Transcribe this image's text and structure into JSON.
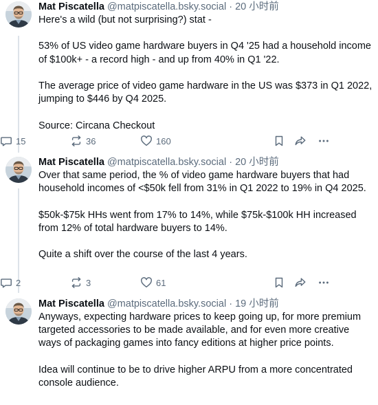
{
  "posts": [
    {
      "author": "Mat Piscatella",
      "handle": "@matpiscatella.bsky.social",
      "separator": "·",
      "time": "20 小时前",
      "paragraphs": [
        "Here's a wild (but not surprising?) stat -",
        "53% of US video game hardware buyers in Q4 '25 had a household income of $100k+ - a record high - and up from 40% in Q1 '22.",
        "The average price of video game hardware in the US was $373 in Q1 2022, jumping to $446 by Q4 2025.",
        "Source: Circana Checkout"
      ],
      "replies": "15",
      "reposts": "36",
      "likes": "160"
    },
    {
      "author": "Mat Piscatella",
      "handle": "@matpiscatella.bsky.social",
      "separator": "·",
      "time": "20 小时前",
      "paragraphs": [
        "Over that same period, the % of video game hardware buyers that had household incomes of <$50k fell from 31% in Q1 2022 to 19% in Q4 2025.",
        "$50k-$75k HHs went from 17% to 14%, while $75k-$100k HH increased from 12% of total hardware buyers to 14%.",
        "Quite a shift over the course of the last 4 years."
      ],
      "replies": "2",
      "reposts": "3",
      "likes": "61"
    },
    {
      "author": "Mat Piscatella",
      "handle": "@matpiscatella.bsky.social",
      "separator": "·",
      "time": "19 小时前",
      "paragraphs": [
        "Anyways, expecting hardware prices to keep going up, for more premium targeted accessories to be made available, and for even more creative ways of packaging games into fancy editions at higher price points.",
        "Idea will continue to be to drive higher ARPU from a more concentrated console audience."
      ]
    }
  ],
  "icons": {
    "reply": "speech-bubble-icon",
    "repost": "repost-arrows-icon",
    "like": "heart-icon",
    "bookmark": "bookmark-icon",
    "share": "share-arrow-icon",
    "more": "ellipsis-icon"
  },
  "colors": {
    "text": "#0b0f14",
    "muted": "#5b6b7c",
    "divider": "#e4e8ec"
  }
}
